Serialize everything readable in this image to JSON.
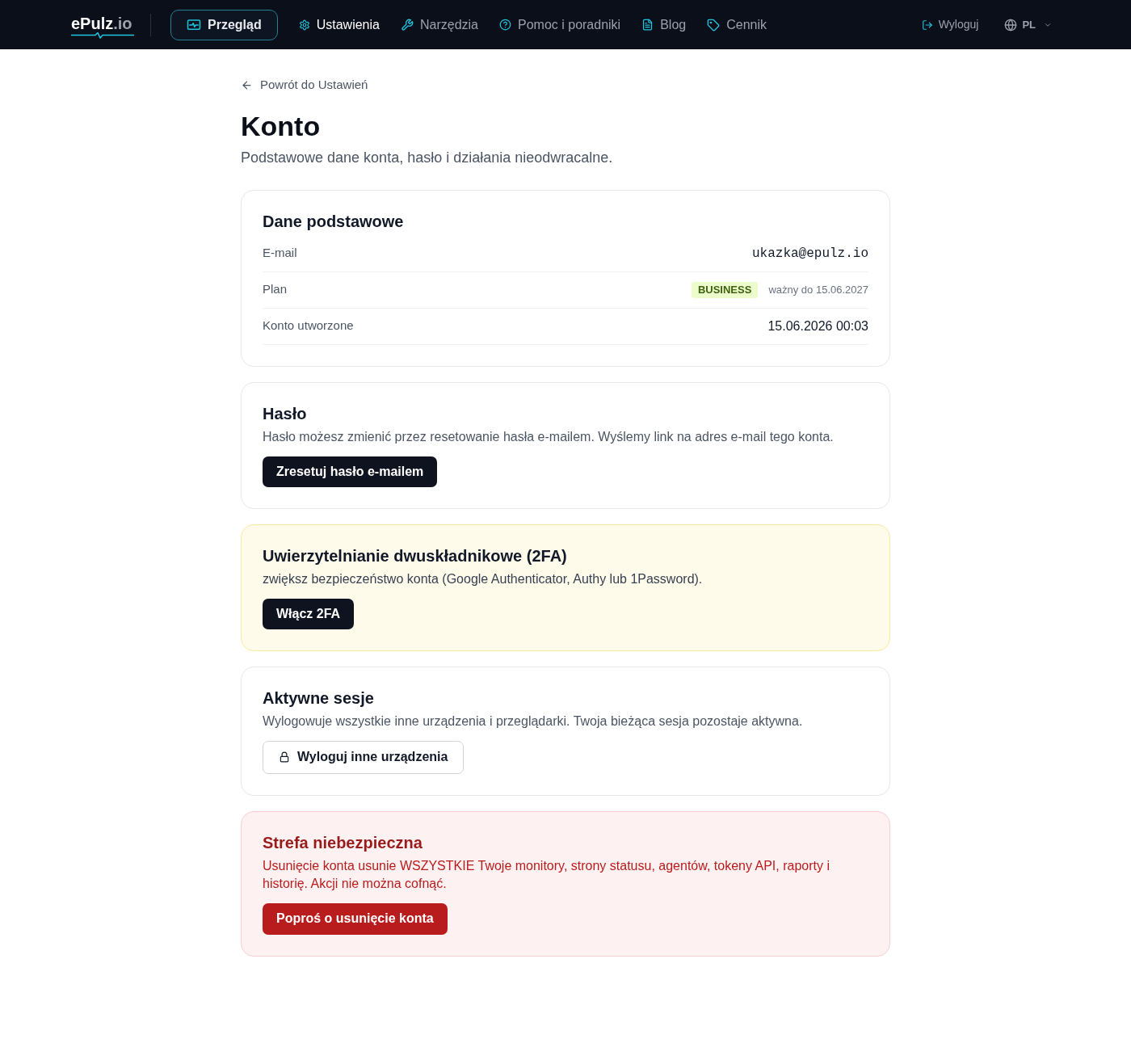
{
  "logo": {
    "name": "ePulz",
    "suffix": ".io"
  },
  "nav": [
    {
      "label": "Przegląd",
      "kind": "overview",
      "selected": true,
      "active": false
    },
    {
      "label": "Ustawienia",
      "kind": "settings",
      "selected": false,
      "active": true
    },
    {
      "label": "Narzędzia",
      "kind": "tools",
      "selected": false,
      "active": false
    },
    {
      "label": "Pomoc i poradniki",
      "kind": "help",
      "selected": false,
      "active": false
    },
    {
      "label": "Blog",
      "kind": "blog",
      "selected": false,
      "active": false
    },
    {
      "label": "Cennik",
      "kind": "pricing",
      "selected": false,
      "active": false
    }
  ],
  "logout": {
    "label": "Wyloguj"
  },
  "language": {
    "label": "PL"
  },
  "back_link": "Powrót do Ustawień",
  "page": {
    "title": "Konto",
    "subtitle": "Podstawowe dane konta, hasło i działania nieodwracalne."
  },
  "sections": [
    {
      "kind": "details",
      "title": "Dane podstawowe",
      "rows": [
        {
          "kind": "mono",
          "label": "E-mail",
          "value": "ukazka@epulz.io"
        },
        {
          "kind": "plan",
          "label": "Plan",
          "badge": "BUSINESS",
          "value": "ważny do 15.06.2027"
        },
        {
          "kind": "text",
          "label": "Konto utworzone",
          "value": "15.06.2026 00:03"
        }
      ]
    },
    {
      "kind": "plain",
      "title": "Hasło",
      "description": "Hasło możesz zmienić przez resetowanie hasła e-mailem. Wyślemy link na adres e-mail tego konta.",
      "button": {
        "kind": "dark",
        "label": "Zresetuj hasło e-mailem"
      }
    },
    {
      "kind": "warning",
      "title": "Uwierzytelnianie dwuskładnikowe (2FA)",
      "description": "zwiększ bezpieczeństwo konta (Google Authenticator, Authy lub 1Password).",
      "button": {
        "kind": "dark",
        "label": "Włącz 2FA"
      }
    },
    {
      "kind": "plain",
      "title": "Aktywne sesje",
      "description": "Wylogowuje wszystkie inne urządzenia i przeglądarki. Twoja bieżąca sesja pozostaje aktywna.",
      "button": {
        "kind": "outline",
        "label": "Wyloguj inne urządzenia"
      }
    },
    {
      "kind": "danger",
      "title": "Strefa niebezpieczna",
      "description": "Usunięcie konta usunie WSZYSTKIE Twoje monitory, strony statusu, agentów, tokeny API, raporty i historię. Akcji nie można cofnąć.",
      "button": {
        "kind": "danger",
        "label": "Poproś o usunięcie konta"
      }
    }
  ]
}
